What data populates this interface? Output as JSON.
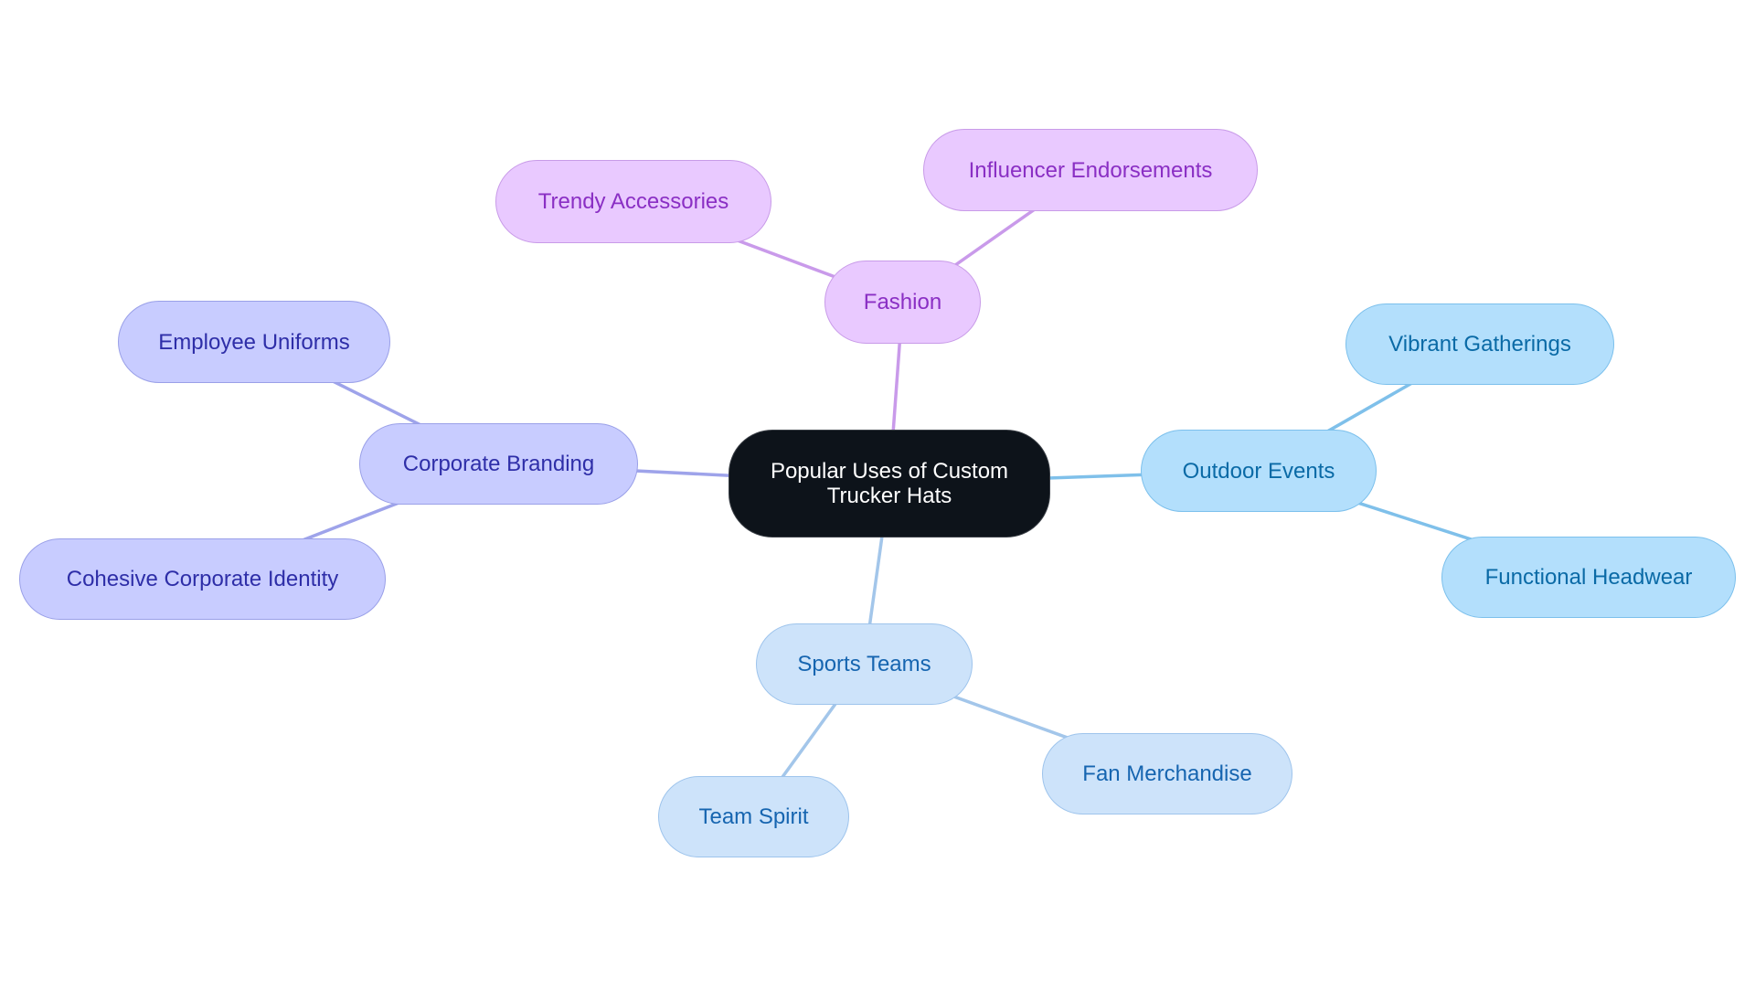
{
  "diagram": {
    "type": "mind-map",
    "root": {
      "id": "root",
      "label": "Popular Uses of Custom Trucker Hats"
    },
    "branches": [
      {
        "id": "fashion",
        "label": "Fashion",
        "theme": "fashion",
        "colors": {
          "fill": "#e9c9ff",
          "stroke": "#c89be8",
          "text": "#8a2fc4",
          "edge": "#c99aea"
        },
        "children": [
          {
            "id": "trendy-accessories",
            "label": "Trendy Accessories"
          },
          {
            "id": "influencer-endorsements",
            "label": "Influencer Endorsements"
          }
        ]
      },
      {
        "id": "corporate-branding",
        "label": "Corporate Branding",
        "theme": "corporate",
        "colors": {
          "fill": "#c8ccff",
          "stroke": "#9aa0e8",
          "text": "#2e2ea8",
          "edge": "#9ea3ea"
        },
        "children": [
          {
            "id": "employee-uniforms",
            "label": "Employee Uniforms"
          },
          {
            "id": "cohesive-corporate-identity",
            "label": "Cohesive Corporate Identity"
          }
        ]
      },
      {
        "id": "outdoor-events",
        "label": "Outdoor Events",
        "theme": "outdoor",
        "colors": {
          "fill": "#b3dffc",
          "stroke": "#7cc0ec",
          "text": "#0a6aa6",
          "edge": "#7fc0ea"
        },
        "children": [
          {
            "id": "vibrant-gatherings",
            "label": "Vibrant Gatherings"
          },
          {
            "id": "functional-headwear",
            "label": "Functional Headwear"
          }
        ]
      },
      {
        "id": "sports-teams",
        "label": "Sports Teams",
        "theme": "sports",
        "colors": {
          "fill": "#cde3fa",
          "stroke": "#9ec4ec",
          "text": "#1665b0",
          "edge": "#a3c6ea"
        },
        "children": [
          {
            "id": "team-spirit",
            "label": "Team Spirit"
          },
          {
            "id": "fan-merchandise",
            "label": "Fan Merchandise"
          }
        ]
      }
    ]
  }
}
